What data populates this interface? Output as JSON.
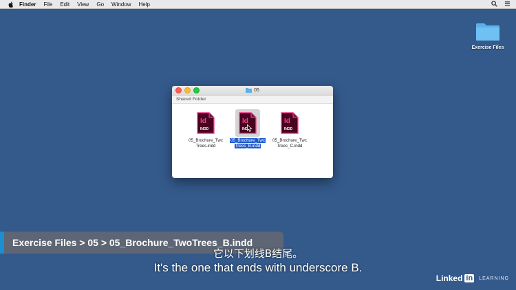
{
  "menubar": {
    "app_name": "Finder",
    "items": [
      "File",
      "Edit",
      "View",
      "Go",
      "Window",
      "Help"
    ]
  },
  "desktop": {
    "folder_label": "Exercise Files"
  },
  "window": {
    "title": "05",
    "shared_label": "Shared Folder",
    "files": [
      {
        "name": "05_Brochure_TwoTrees.indd",
        "line1": "05_Brochure_Twc",
        "line2": "Trees.indd",
        "selected": false,
        "badge": "INDD",
        "logo": "Id"
      },
      {
        "name": "05_Brochure_TwoTrees_B.indd",
        "line1": "05_Brochure_Twc",
        "line2": "Trees_B.indd",
        "selected": true,
        "badge": "INDD",
        "logo": "Id"
      },
      {
        "name": "05_Brochure_TwoTrees_C.indd",
        "line1": "05_Brochure_Twc",
        "line2": "Trees_C.indd",
        "selected": false,
        "badge": "INDD",
        "logo": "Id"
      }
    ]
  },
  "overlay": {
    "path": "Exercise Files > 05 > 05_Brochure_TwoTrees_B.indd",
    "subtitle_cn": "它以下划线B结尾。",
    "subtitle_en": "It's the one that ends with underscore B.",
    "brand_linked": "Linked",
    "brand_in": "in",
    "brand_learning": "LEARNING"
  },
  "colors": {
    "desktop": "#345a8c",
    "selection": "#1f5bd0",
    "indd_pink": "#ff3f94",
    "indd_bg": "#49021f",
    "accent": "#1b8fd0"
  },
  "icons": [
    "apple-icon",
    "search-icon",
    "control-center-icon",
    "folder-icon",
    "indesign-file-icon",
    "cursor-icon"
  ]
}
